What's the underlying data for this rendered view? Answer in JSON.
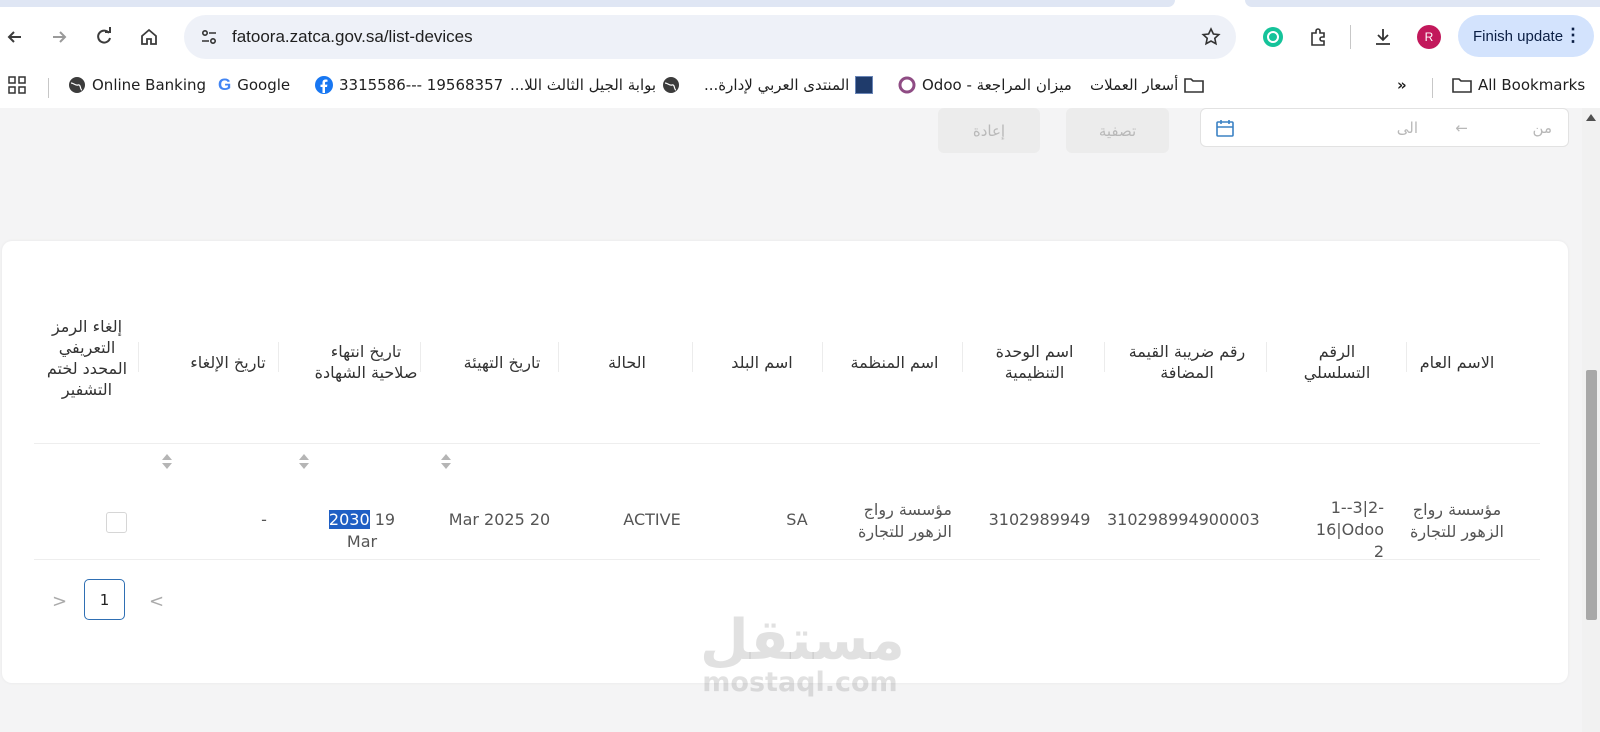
{
  "browser": {
    "url": "fatoora.zatca.gov.sa/list-devices",
    "avatar_letter": "R",
    "finish_update_label": "Finish update",
    "bookmarks": [
      {
        "label": "Online Banking",
        "icon": "globe-icon"
      },
      {
        "label": "Google",
        "icon": "google-icon"
      },
      {
        "label": "3315586--- 19568357",
        "icon": "facebook-icon"
      },
      {
        "label": "بوابة الجيل الثالث اللا...",
        "icon": "globe-icon"
      },
      {
        "label": "المنتدى العربي لإدارة...",
        "icon": "site-icon"
      },
      {
        "label": "Odoo - ميزان المراجعة",
        "icon": "odoo-icon"
      },
      {
        "label": "أسعار العملات",
        "icon": "folder-icon"
      }
    ],
    "overflow_label": "»",
    "all_bookmarks_label": "All Bookmarks"
  },
  "filters": {
    "date_from_placeholder": "من",
    "date_arrow": "←",
    "date_to_placeholder": "الى",
    "filter_button": "تصفية",
    "reset_button": "إعادة"
  },
  "table": {
    "headers": {
      "common_name": "الاسم العام",
      "serial": "الرقم التسلسلي",
      "vat": "رقم ضريبة القيمة المضافة",
      "org_unit": "اسم الوحدة التنظيمية",
      "org_name": "اسم المنظمة",
      "country": "اسم البلد",
      "status": "الحالة",
      "onboarding_date": "تاريخ التهيئة",
      "cert_expiry": "تاريخ انتهاء صلاحية الشهادة",
      "revoke_date": "تاريخ الإلغاء",
      "revoke_csid": "إلغاء الرمز التعريفي المحدد لختم التشفير"
    },
    "rows": [
      {
        "common_name": "مؤسسة رواج الزهور للتجارة",
        "serial_line1": "1--3|2-16|Odoo",
        "serial_line2": "2",
        "vat": "310298994900003",
        "org_unit": "3102989949",
        "org_name": "مؤسسة رواج الزهور للتجارة",
        "country": "SA",
        "status": "ACTIVE",
        "onboarding_date": "20 Mar 2025",
        "cert_expiry_day": "19",
        "cert_expiry_year": "2030",
        "cert_expiry_month": "Mar",
        "revoke_date": "-"
      }
    ]
  },
  "pagination": {
    "current_page": "1",
    "prev": "<",
    "next": ">"
  },
  "watermark": {
    "arabic": "مستقل",
    "latin": "mostaql.com"
  }
}
